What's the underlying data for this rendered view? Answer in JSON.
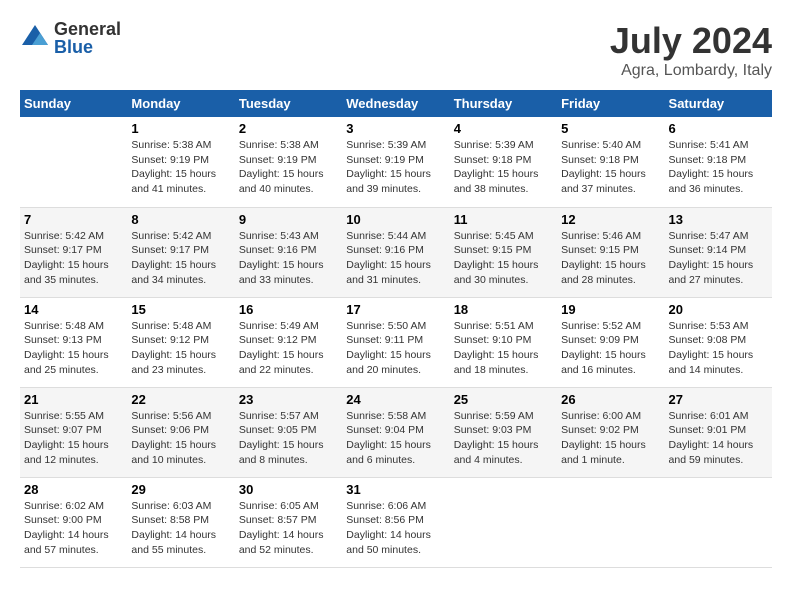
{
  "logo": {
    "general": "General",
    "blue": "Blue"
  },
  "title": {
    "month": "July 2024",
    "location": "Agra, Lombardy, Italy"
  },
  "headers": [
    "Sunday",
    "Monday",
    "Tuesday",
    "Wednesday",
    "Thursday",
    "Friday",
    "Saturday"
  ],
  "weeks": [
    [
      {
        "day": "",
        "info": ""
      },
      {
        "day": "1",
        "info": "Sunrise: 5:38 AM\nSunset: 9:19 PM\nDaylight: 15 hours\nand 41 minutes."
      },
      {
        "day": "2",
        "info": "Sunrise: 5:38 AM\nSunset: 9:19 PM\nDaylight: 15 hours\nand 40 minutes."
      },
      {
        "day": "3",
        "info": "Sunrise: 5:39 AM\nSunset: 9:19 PM\nDaylight: 15 hours\nand 39 minutes."
      },
      {
        "day": "4",
        "info": "Sunrise: 5:39 AM\nSunset: 9:18 PM\nDaylight: 15 hours\nand 38 minutes."
      },
      {
        "day": "5",
        "info": "Sunrise: 5:40 AM\nSunset: 9:18 PM\nDaylight: 15 hours\nand 37 minutes."
      },
      {
        "day": "6",
        "info": "Sunrise: 5:41 AM\nSunset: 9:18 PM\nDaylight: 15 hours\nand 36 minutes."
      }
    ],
    [
      {
        "day": "7",
        "info": "Sunrise: 5:42 AM\nSunset: 9:17 PM\nDaylight: 15 hours\nand 35 minutes."
      },
      {
        "day": "8",
        "info": "Sunrise: 5:42 AM\nSunset: 9:17 PM\nDaylight: 15 hours\nand 34 minutes."
      },
      {
        "day": "9",
        "info": "Sunrise: 5:43 AM\nSunset: 9:16 PM\nDaylight: 15 hours\nand 33 minutes."
      },
      {
        "day": "10",
        "info": "Sunrise: 5:44 AM\nSunset: 9:16 PM\nDaylight: 15 hours\nand 31 minutes."
      },
      {
        "day": "11",
        "info": "Sunrise: 5:45 AM\nSunset: 9:15 PM\nDaylight: 15 hours\nand 30 minutes."
      },
      {
        "day": "12",
        "info": "Sunrise: 5:46 AM\nSunset: 9:15 PM\nDaylight: 15 hours\nand 28 minutes."
      },
      {
        "day": "13",
        "info": "Sunrise: 5:47 AM\nSunset: 9:14 PM\nDaylight: 15 hours\nand 27 minutes."
      }
    ],
    [
      {
        "day": "14",
        "info": "Sunrise: 5:48 AM\nSunset: 9:13 PM\nDaylight: 15 hours\nand 25 minutes."
      },
      {
        "day": "15",
        "info": "Sunrise: 5:48 AM\nSunset: 9:12 PM\nDaylight: 15 hours\nand 23 minutes."
      },
      {
        "day": "16",
        "info": "Sunrise: 5:49 AM\nSunset: 9:12 PM\nDaylight: 15 hours\nand 22 minutes."
      },
      {
        "day": "17",
        "info": "Sunrise: 5:50 AM\nSunset: 9:11 PM\nDaylight: 15 hours\nand 20 minutes."
      },
      {
        "day": "18",
        "info": "Sunrise: 5:51 AM\nSunset: 9:10 PM\nDaylight: 15 hours\nand 18 minutes."
      },
      {
        "day": "19",
        "info": "Sunrise: 5:52 AM\nSunset: 9:09 PM\nDaylight: 15 hours\nand 16 minutes."
      },
      {
        "day": "20",
        "info": "Sunrise: 5:53 AM\nSunset: 9:08 PM\nDaylight: 15 hours\nand 14 minutes."
      }
    ],
    [
      {
        "day": "21",
        "info": "Sunrise: 5:55 AM\nSunset: 9:07 PM\nDaylight: 15 hours\nand 12 minutes."
      },
      {
        "day": "22",
        "info": "Sunrise: 5:56 AM\nSunset: 9:06 PM\nDaylight: 15 hours\nand 10 minutes."
      },
      {
        "day": "23",
        "info": "Sunrise: 5:57 AM\nSunset: 9:05 PM\nDaylight: 15 hours\nand 8 minutes."
      },
      {
        "day": "24",
        "info": "Sunrise: 5:58 AM\nSunset: 9:04 PM\nDaylight: 15 hours\nand 6 minutes."
      },
      {
        "day": "25",
        "info": "Sunrise: 5:59 AM\nSunset: 9:03 PM\nDaylight: 15 hours\nand 4 minutes."
      },
      {
        "day": "26",
        "info": "Sunrise: 6:00 AM\nSunset: 9:02 PM\nDaylight: 15 hours\nand 1 minute."
      },
      {
        "day": "27",
        "info": "Sunrise: 6:01 AM\nSunset: 9:01 PM\nDaylight: 14 hours\nand 59 minutes."
      }
    ],
    [
      {
        "day": "28",
        "info": "Sunrise: 6:02 AM\nSunset: 9:00 PM\nDaylight: 14 hours\nand 57 minutes."
      },
      {
        "day": "29",
        "info": "Sunrise: 6:03 AM\nSunset: 8:58 PM\nDaylight: 14 hours\nand 55 minutes."
      },
      {
        "day": "30",
        "info": "Sunrise: 6:05 AM\nSunset: 8:57 PM\nDaylight: 14 hours\nand 52 minutes."
      },
      {
        "day": "31",
        "info": "Sunrise: 6:06 AM\nSunset: 8:56 PM\nDaylight: 14 hours\nand 50 minutes."
      },
      {
        "day": "",
        "info": ""
      },
      {
        "day": "",
        "info": ""
      },
      {
        "day": "",
        "info": ""
      }
    ]
  ]
}
